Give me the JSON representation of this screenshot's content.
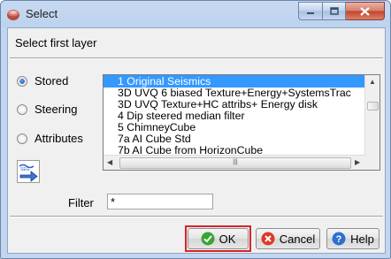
{
  "window": {
    "title": "Select"
  },
  "header": {
    "text": "Select first layer"
  },
  "modes": [
    {
      "label": "Stored",
      "selected": true
    },
    {
      "label": "Steering",
      "selected": false
    },
    {
      "label": "Attributes",
      "selected": false
    }
  ],
  "layers": {
    "items": [
      "1 Original Seismics",
      "3D UVQ 6 biased Texture+Energy+SystemsTrac",
      "3D UVQ Texture+HC attribs+ Energy disk",
      "4 Dip steered median filter",
      "5 ChimneyCube",
      "7a AI Cube Std",
      "7b AI Cube from HorizonCube"
    ],
    "selected_index": 0
  },
  "filter": {
    "label": "Filter",
    "value": "*"
  },
  "buttons": {
    "ok": "OK",
    "cancel": "Cancel",
    "help": "Help"
  },
  "colors": {
    "selection": "#3399ff",
    "focus_highlight": "#d8232a"
  }
}
